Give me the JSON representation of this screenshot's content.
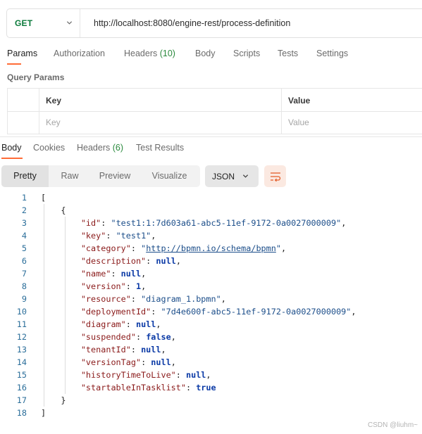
{
  "request": {
    "method": "GET",
    "url": "http://localhost:8080/engine-rest/process-definition"
  },
  "request_tabs": [
    {
      "label": "Params",
      "count": ""
    },
    {
      "label": "Authorization",
      "count": ""
    },
    {
      "label": "Headers",
      "count": "(10)"
    },
    {
      "label": "Body",
      "count": ""
    },
    {
      "label": "Scripts",
      "count": ""
    },
    {
      "label": "Tests",
      "count": ""
    },
    {
      "label": "Settings",
      "count": ""
    }
  ],
  "query_params": {
    "title": "Query Params",
    "header_key": "Key",
    "header_value": "Value",
    "placeholder_key": "Key",
    "placeholder_value": "Value"
  },
  "response_tabs": [
    {
      "label": "Body",
      "count": ""
    },
    {
      "label": "Cookies",
      "count": ""
    },
    {
      "label": "Headers",
      "count": "(6)"
    },
    {
      "label": "Test Results",
      "count": ""
    }
  ],
  "view_modes": [
    "Pretty",
    "Raw",
    "Preview",
    "Visualize"
  ],
  "format": "JSON",
  "accent_color": "#ff6c37",
  "response_lines": [
    {
      "n": "1",
      "tokens": [
        [
          "p",
          "["
        ]
      ]
    },
    {
      "n": "2",
      "tokens": [
        [
          "p",
          "    {"
        ]
      ]
    },
    {
      "n": "3",
      "tokens": [
        [
          "p",
          "        "
        ],
        [
          "k",
          "\"id\""
        ],
        [
          "p",
          ": "
        ],
        [
          "s",
          "\"test1:1:7d603a61-abc5-11ef-9172-0a0027000009\""
        ],
        [
          "p",
          ","
        ]
      ]
    },
    {
      "n": "4",
      "tokens": [
        [
          "p",
          "        "
        ],
        [
          "k",
          "\"key\""
        ],
        [
          "p",
          ": "
        ],
        [
          "s",
          "\"test1\""
        ],
        [
          "p",
          ","
        ]
      ]
    },
    {
      "n": "5",
      "tokens": [
        [
          "p",
          "        "
        ],
        [
          "k",
          "\"category\""
        ],
        [
          "p",
          ": "
        ],
        [
          "s",
          "\""
        ],
        [
          "u",
          "http://bpmn.io/schema/bpmn"
        ],
        [
          "s",
          "\""
        ],
        [
          "p",
          ","
        ]
      ]
    },
    {
      "n": "6",
      "tokens": [
        [
          "p",
          "        "
        ],
        [
          "k",
          "\"description\""
        ],
        [
          "p",
          ": "
        ],
        [
          "l",
          "null"
        ],
        [
          "p",
          ","
        ]
      ]
    },
    {
      "n": "7",
      "tokens": [
        [
          "p",
          "        "
        ],
        [
          "k",
          "\"name\""
        ],
        [
          "p",
          ": "
        ],
        [
          "l",
          "null"
        ],
        [
          "p",
          ","
        ]
      ]
    },
    {
      "n": "8",
      "tokens": [
        [
          "p",
          "        "
        ],
        [
          "k",
          "\"version\""
        ],
        [
          "p",
          ": "
        ],
        [
          "l",
          "1"
        ],
        [
          "p",
          ","
        ]
      ]
    },
    {
      "n": "9",
      "tokens": [
        [
          "p",
          "        "
        ],
        [
          "k",
          "\"resource\""
        ],
        [
          "p",
          ": "
        ],
        [
          "s",
          "\"diagram_1.bpmn\""
        ],
        [
          "p",
          ","
        ]
      ]
    },
    {
      "n": "10",
      "tokens": [
        [
          "p",
          "        "
        ],
        [
          "k",
          "\"deploymentId\""
        ],
        [
          "p",
          ": "
        ],
        [
          "s",
          "\"7d4e600f-abc5-11ef-9172-0a0027000009\""
        ],
        [
          "p",
          ","
        ]
      ]
    },
    {
      "n": "11",
      "tokens": [
        [
          "p",
          "        "
        ],
        [
          "k",
          "\"diagram\""
        ],
        [
          "p",
          ": "
        ],
        [
          "l",
          "null"
        ],
        [
          "p",
          ","
        ]
      ]
    },
    {
      "n": "12",
      "tokens": [
        [
          "p",
          "        "
        ],
        [
          "k",
          "\"suspended\""
        ],
        [
          "p",
          ": "
        ],
        [
          "l",
          "false"
        ],
        [
          "p",
          ","
        ]
      ]
    },
    {
      "n": "13",
      "tokens": [
        [
          "p",
          "        "
        ],
        [
          "k",
          "\"tenantId\""
        ],
        [
          "p",
          ": "
        ],
        [
          "l",
          "null"
        ],
        [
          "p",
          ","
        ]
      ]
    },
    {
      "n": "14",
      "tokens": [
        [
          "p",
          "        "
        ],
        [
          "k",
          "\"versionTag\""
        ],
        [
          "p",
          ": "
        ],
        [
          "l",
          "null"
        ],
        [
          "p",
          ","
        ]
      ]
    },
    {
      "n": "15",
      "tokens": [
        [
          "p",
          "        "
        ],
        [
          "k",
          "\"historyTimeToLive\""
        ],
        [
          "p",
          ": "
        ],
        [
          "l",
          "null"
        ],
        [
          "p",
          ","
        ]
      ]
    },
    {
      "n": "16",
      "tokens": [
        [
          "p",
          "        "
        ],
        [
          "k",
          "\"startableInTasklist\""
        ],
        [
          "p",
          ": "
        ],
        [
          "l",
          "true"
        ]
      ]
    },
    {
      "n": "17",
      "tokens": [
        [
          "p",
          "    }"
        ]
      ]
    },
    {
      "n": "18",
      "tokens": [
        [
          "p",
          "]"
        ]
      ]
    }
  ],
  "watermark": "CSDN @liuhm~"
}
